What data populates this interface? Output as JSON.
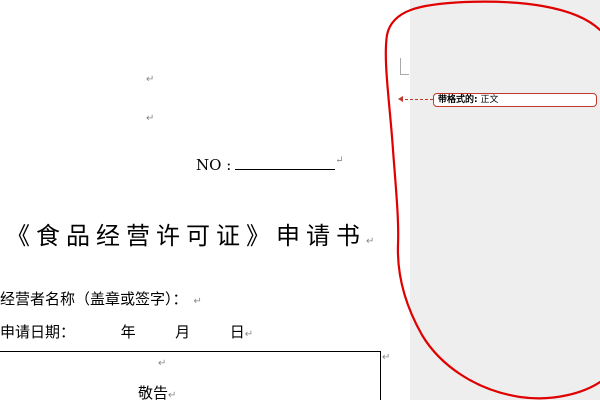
{
  "document": {
    "para_mark": "↵",
    "no_label": "NO :",
    "title": "《食品经营许可证》申请书",
    "operator_label": "经营者名称（盖章或签字）：",
    "date_label": "申请日期：",
    "year": "年",
    "month": "月",
    "day": "日",
    "box_label": "敬告"
  },
  "markup": {
    "balloon_prefix": "带格式的:",
    "balloon_value": "正文"
  },
  "colors": {
    "markup_pane": "#eeeeee",
    "balloon_border": "#c0392b",
    "annotation_circle": "#e00000"
  }
}
